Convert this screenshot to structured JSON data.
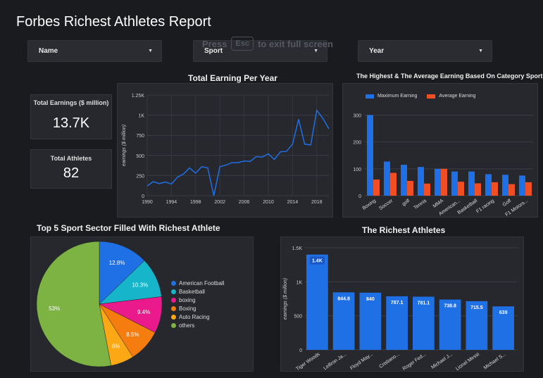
{
  "header": {
    "title": "Forbes Richest Athletes Report"
  },
  "filters": [
    {
      "label": "Name"
    },
    {
      "label": "Sport"
    },
    {
      "label": "Year"
    }
  ],
  "fullscreen_hint": {
    "press": "Press",
    "key": "Esc",
    "rest": "to exit full screen"
  },
  "kpis": {
    "total_earnings": {
      "label": "Total Earnings ($ million)",
      "value": "13.7K"
    },
    "total_athletes": {
      "label": "Total Athletes",
      "value": "82"
    }
  },
  "chart_data": [
    {
      "id": "earning_per_year",
      "type": "line",
      "title": "Total Earning Per Year",
      "ylabel": "earnings ($ million)",
      "xlabel": "",
      "x": [
        1990,
        1991,
        1992,
        1993,
        1994,
        1995,
        1996,
        1997,
        1998,
        1999,
        2000,
        2001,
        2002,
        2003,
        2004,
        2005,
        2006,
        2007,
        2008,
        2009,
        2010,
        2011,
        2012,
        2013,
        2014,
        2015,
        2016,
        2017,
        2018,
        2019,
        2020
      ],
      "values": [
        120,
        175,
        150,
        170,
        145,
        230,
        270,
        345,
        280,
        360,
        345,
        0,
        360,
        380,
        410,
        410,
        430,
        425,
        485,
        480,
        520,
        450,
        545,
        550,
        640,
        950,
        640,
        630,
        1060,
        960,
        830
      ],
      "ylim": [
        0,
        1250
      ],
      "yticks": [
        "0",
        "250",
        "500",
        "750",
        "1K",
        "1.25K"
      ],
      "xticks": [
        "1990",
        "1994",
        "1998",
        "2002",
        "2006",
        "2010",
        "2014",
        "2018"
      ],
      "color": "#1f6fe5"
    },
    {
      "id": "category_sport",
      "type": "bar",
      "title": "The Highest & The Average Earning Based On Category Sport",
      "categories": [
        "Boxing",
        "Soccer",
        "golf",
        "Tennis",
        "MMA",
        "American...",
        "Basketball",
        "F1 racing",
        "Golf",
        "F1 Motors..."
      ],
      "series": [
        {
          "name": "Maximum Earning",
          "values": [
            300,
            127,
            115,
            107,
            100,
            90,
            90,
            80,
            78,
            75
          ],
          "color": "#1f6fe5"
        },
        {
          "name": "Average Earning",
          "values": [
            60,
            85,
            55,
            45,
            100,
            52,
            46,
            50,
            43,
            50
          ],
          "color": "#f04e23"
        }
      ],
      "ylim": [
        0,
        330
      ],
      "yticks": [
        "0",
        "100",
        "200",
        "300"
      ]
    },
    {
      "id": "top5_sector",
      "type": "pie",
      "title": "Top 5 Sport Sector Filled With Richest Athlete",
      "slices": [
        {
          "name": "American Football",
          "value": 12.8,
          "label": "12.8%",
          "color": "#1f6fe5"
        },
        {
          "name": "Basketball",
          "value": 10.3,
          "label": "10.3%",
          "color": "#16b5c9"
        },
        {
          "name": "boxing",
          "value": 9.4,
          "label": "9.4%",
          "color": "#ea1a8c"
        },
        {
          "name": "Boxing",
          "value": 8.5,
          "label": "8.5%",
          "color": "#f57c0f"
        },
        {
          "name": "Auto Racing",
          "value": 6,
          "label": "6%",
          "color": "#fba814"
        },
        {
          "name": "others",
          "value": 53,
          "label": "53%",
          "color": "#7cb342"
        }
      ]
    },
    {
      "id": "richest_athletes",
      "type": "bar",
      "title": "The Richest Athletes",
      "ylabel": "earnings ($ million)",
      "categories": [
        "Tiger Woods",
        "LeBron Ja...",
        "Floyd May...",
        "Cristiano...",
        "Roger Fed...",
        "Michael J...",
        "Lionel Messi",
        "Michael S..."
      ],
      "values": [
        1400,
        844.8,
        840,
        787.1,
        781.1,
        738.8,
        715.5,
        639
      ],
      "data_labels": [
        "1.4K",
        "844.8",
        "840",
        "787.1",
        "781.1",
        "738.8",
        "715.5",
        "639"
      ],
      "ylim": [
        0,
        1500
      ],
      "yticks": [
        "0",
        "500",
        "1K",
        "1.5K"
      ],
      "color": "#1f6fe5"
    }
  ]
}
